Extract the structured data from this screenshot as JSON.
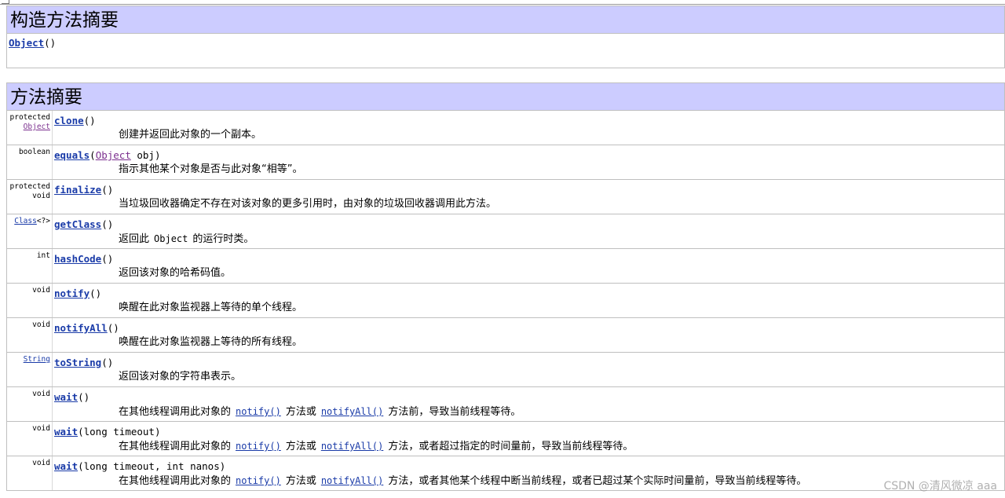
{
  "constructor_summary": {
    "title": "构造方法摘要",
    "constructor": {
      "name": "Object",
      "params": "()"
    }
  },
  "method_summary": {
    "title": "方法摘要",
    "methods": [
      {
        "modifier": "protected",
        "return_link": "Object",
        "name": "clone",
        "params": "()",
        "desc": "创建并返回此对象的一个副本。"
      },
      {
        "modifier": "boolean",
        "name": "equals",
        "param_open": "(",
        "param_link": "Object",
        "param_rest": " obj)",
        "desc": "指示其他某个对象是否与此对象“相等”。"
      },
      {
        "modifier": "protected",
        "modifier2": "void",
        "name": "finalize",
        "params": "()",
        "desc": "当垃圾回收器确定不存在对该对象的更多引用时，由对象的垃圾回收器调用此方法。"
      },
      {
        "return_link": "Class",
        "return_suffix": "<?>",
        "name": "getClass",
        "params": "()",
        "desc_pre": "返回此",
        "desc_code": "Object",
        "desc_post": "的运行时类。"
      },
      {
        "modifier": "int",
        "name": "hashCode",
        "params": "()",
        "desc": "返回该对象的哈希码值。"
      },
      {
        "modifier": "void",
        "name": "notify",
        "params": "()",
        "desc": "唤醒在此对象监视器上等待的单个线程。"
      },
      {
        "modifier": "void",
        "name": "notifyAll",
        "params": "()",
        "desc": "唤醒在此对象监视器上等待的所有线程。"
      },
      {
        "return_link": "String",
        "name": "toString",
        "params": "()",
        "desc": "返回该对象的字符串表示。"
      },
      {
        "modifier": "void",
        "name": "wait",
        "params": "()",
        "desc_a": "在其他线程调用此对象的",
        "link1": "notify()",
        "desc_b": "方法或",
        "link2": "notifyAll()",
        "desc_c": "方法前，导致当前线程等待。"
      },
      {
        "modifier": "void",
        "name": "wait",
        "params": "(long timeout)",
        "desc_a": "在其他线程调用此对象的",
        "link1": "notify()",
        "desc_b": "方法或",
        "link2": "notifyAll()",
        "desc_c": "方法，或者超过指定的时间量前，导致当前线程等待。"
      },
      {
        "modifier": "void",
        "name": "wait",
        "params": "(long timeout, int nanos)",
        "desc_a": "在其他线程调用此对象的",
        "link1": "notify()",
        "desc_b": "方法或",
        "link2": "notifyAll()",
        "desc_c": "方法，或者其他某个线程中断当前线程，或者已超过某个实际时间量前，导致当前线程等待。"
      }
    ]
  },
  "watermark": "CSDN @清风微凉 aaa"
}
